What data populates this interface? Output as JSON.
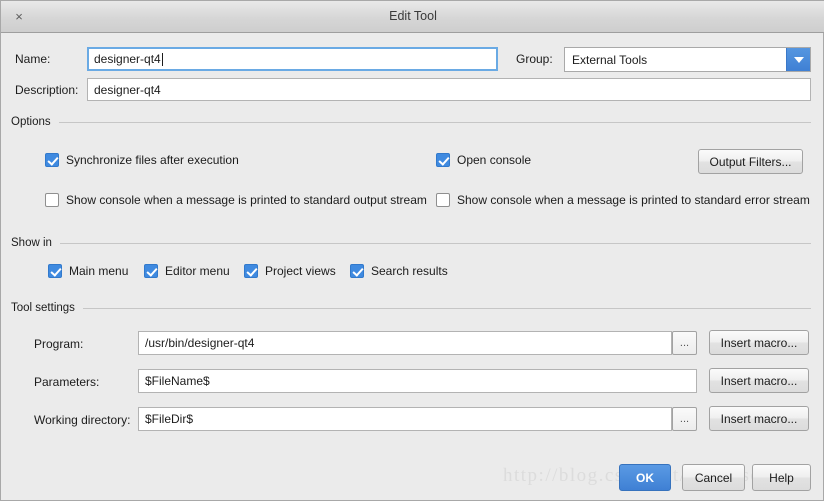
{
  "window": {
    "title": "Edit Tool",
    "close_label": "×"
  },
  "form": {
    "name_label": "Name:",
    "name_value": "designer-qt4",
    "group_label": "Group:",
    "group_value": "External Tools",
    "description_label": "Description:",
    "description_value": "designer-qt4"
  },
  "options": {
    "title": "Options",
    "sync_files": "Synchronize files after execution",
    "open_console": "Open console",
    "show_console_stdout": "Show console when a message is printed to standard output stream",
    "show_console_stderr": "Show console when a message is printed to standard error stream",
    "output_filters_button": "Output Filters..."
  },
  "show_in": {
    "title": "Show in",
    "items": [
      {
        "label": "Main menu",
        "checked": true
      },
      {
        "label": "Editor menu",
        "checked": true
      },
      {
        "label": "Project views",
        "checked": true
      },
      {
        "label": "Search results",
        "checked": true
      }
    ]
  },
  "tool_settings": {
    "title": "Tool settings",
    "program_label": "Program:",
    "program_value": "/usr/bin/designer-qt4",
    "parameters_label": "Parameters:",
    "parameters_value": "$FileName$",
    "working_dir_label": "Working directory:",
    "working_dir_value": "$FileDir$",
    "browse_label": "...",
    "insert_macro_label": "Insert macro..."
  },
  "footer": {
    "ok": "OK",
    "cancel": "Cancel",
    "help": "Help"
  },
  "watermark": {
    "text": "http://blog.csdn.net/jxm_csdn"
  },
  "colors": {
    "accent": "#3f80d4",
    "window_bg": "#ebebeb",
    "field_bg": "#ffffff",
    "focus_border": "#6aaae4"
  }
}
